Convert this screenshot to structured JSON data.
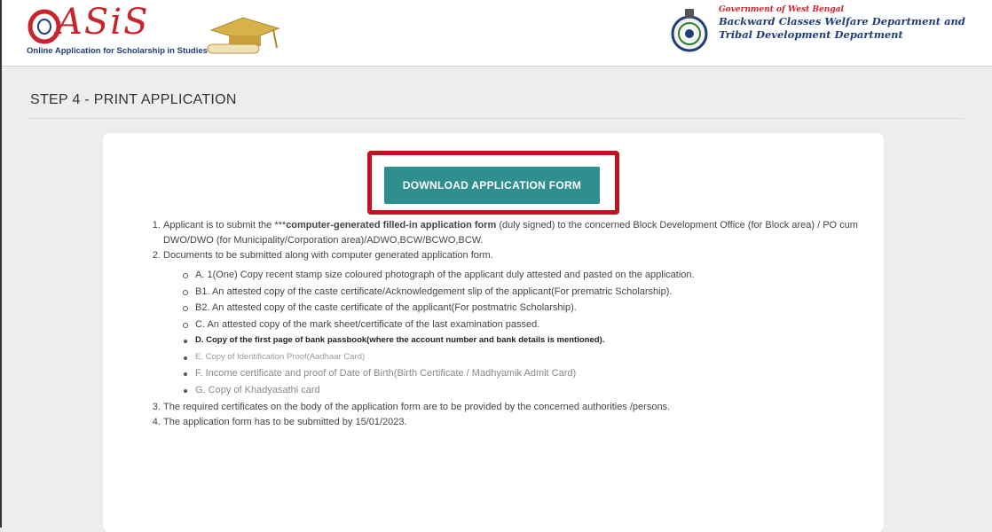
{
  "header": {
    "logo_text": "ASiS",
    "logo_tagline": "Online Application for Scholarship in Studies",
    "gov_line1": "Government of West Bengal",
    "gov_line2": "Backward Classes Welfare Department and",
    "gov_line3": "Tribal Development Department"
  },
  "page": {
    "step_title": "STEP 4 - PRINT APPLICATION",
    "download_button": "DOWNLOAD APPLICATION FORM"
  },
  "instructions": {
    "item1_prefix": "Applicant is to submit the ***",
    "item1_bold": "computer-generated filled-in application form",
    "item1_suffix": " (duly signed) to the concerned Block Development Office (for Block area) / PO cum DWO/DWO (for Municipality/Corporation area)/ADWO,BCW/BCWO,BCW.",
    "item2": "Documents to be submitted along with computer generated application form.",
    "sub_items": [
      "A. 1(One) Copy recent stamp size coloured photograph of the applicant duly attested and pasted on the application.",
      "B1. An attested copy of the caste certificate/Acknowledgement slip of the applicant(For prematric Scholarship).",
      "B2. An attested copy of the caste certificate of the applicant(For postmatric Scholarship).",
      "C. An attested copy of the mark sheet/certificate of the last examination passed.",
      "D. Copy of the first page of bank passbook(where the account number and bank details is mentioned).",
      "E. Copy of Identification Proof(Aadhaar Card)",
      "F. Income certificate and proof of Date of Birth(Birth Certificate / Madhyamik Admit Card)",
      "G. Copy of Khadyasathi card"
    ],
    "item3": "The required certificates on the body of the application form are to be provided by the concerned authorities /persons.",
    "item4": "The application form has to be submitted by 15/01/2023."
  },
  "colors": {
    "button": "#2f8f8f",
    "highlight": "#c1121f",
    "logo_red": "#c9242b",
    "gov_blue": "#1f3d7a"
  }
}
